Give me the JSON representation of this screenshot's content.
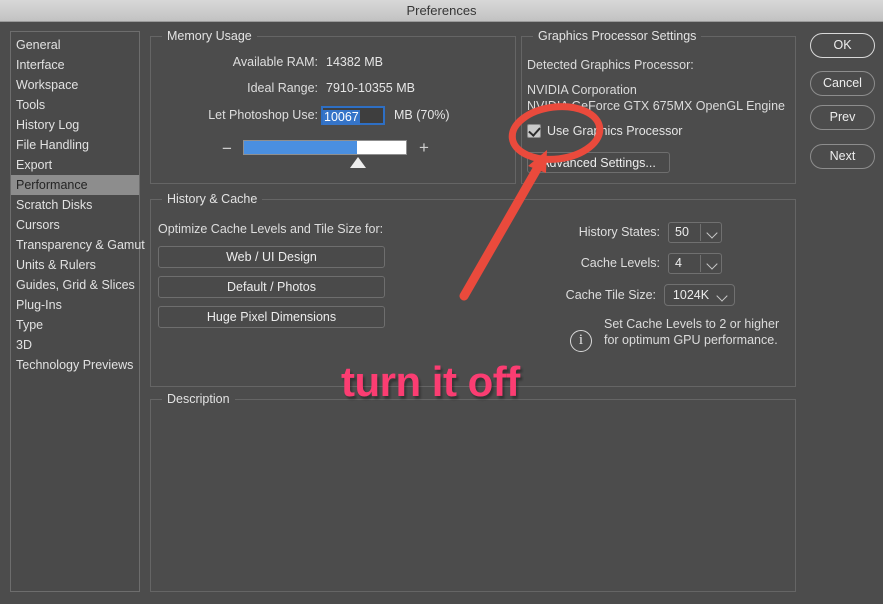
{
  "window": {
    "title": "Preferences"
  },
  "sidebar": {
    "items": [
      {
        "label": "General",
        "selected": false
      },
      {
        "label": "Interface",
        "selected": false
      },
      {
        "label": "Workspace",
        "selected": false
      },
      {
        "label": "Tools",
        "selected": false
      },
      {
        "label": "History Log",
        "selected": false
      },
      {
        "label": "File Handling",
        "selected": false
      },
      {
        "label": "Export",
        "selected": false
      },
      {
        "label": "Performance",
        "selected": true
      },
      {
        "label": "Scratch Disks",
        "selected": false
      },
      {
        "label": "Cursors",
        "selected": false
      },
      {
        "label": "Transparency & Gamut",
        "selected": false
      },
      {
        "label": "Units & Rulers",
        "selected": false
      },
      {
        "label": "Guides, Grid & Slices",
        "selected": false
      },
      {
        "label": "Plug-Ins",
        "selected": false
      },
      {
        "label": "Type",
        "selected": false
      },
      {
        "label": "3D",
        "selected": false
      },
      {
        "label": "Technology Previews",
        "selected": false
      }
    ]
  },
  "memory_usage": {
    "legend": "Memory Usage",
    "available_ram_label": "Available RAM:",
    "available_ram_value": "14382 MB",
    "ideal_range_label": "Ideal Range:",
    "ideal_range_value": "7910-10355 MB",
    "let_photoshop_use_label": "Let Photoshop Use:",
    "let_photoshop_use_value": "10067",
    "unit_suffix": "MB (70%)",
    "slider_minus": "−",
    "slider_plus": "+",
    "slider_percent": 70
  },
  "graphics_processor": {
    "legend": "Graphics Processor Settings",
    "detected_label": "Detected Graphics Processor:",
    "vendor": "NVIDIA Corporation",
    "device": "NVIDIA GeForce GTX 675MX OpenGL Engine",
    "use_gpu_label": "Use Graphics Processor",
    "use_gpu_checked": true,
    "advanced_settings_label": "Advanced Settings..."
  },
  "history_cache": {
    "legend": "History & Cache",
    "optimize_label": "Optimize Cache Levels and Tile Size for:",
    "presets": [
      {
        "label": "Web / UI Design"
      },
      {
        "label": "Default / Photos"
      },
      {
        "label": "Huge Pixel Dimensions"
      }
    ],
    "history_states_label": "History States:",
    "history_states_value": "50",
    "cache_levels_label": "Cache Levels:",
    "cache_levels_value": "4",
    "cache_tile_size_label": "Cache Tile Size:",
    "cache_tile_size_value": "1024K",
    "info_glyph": "i",
    "info_line1": "Set Cache Levels to 2 or higher",
    "info_line2": "for optimum GPU performance."
  },
  "description": {
    "legend": "Description",
    "body": ""
  },
  "buttons": [
    {
      "label": "OK",
      "primary": true
    },
    {
      "label": "Cancel",
      "primary": false
    },
    {
      "label": "Prev",
      "primary": false
    },
    {
      "label": "Next",
      "primary": false
    }
  ],
  "annotations": {
    "text": "turn it off",
    "text_color": "#fb3d72",
    "marker_color": "#ea4a3c",
    "shapes": [
      "ellipse-highlight",
      "arrow-pointer"
    ]
  }
}
